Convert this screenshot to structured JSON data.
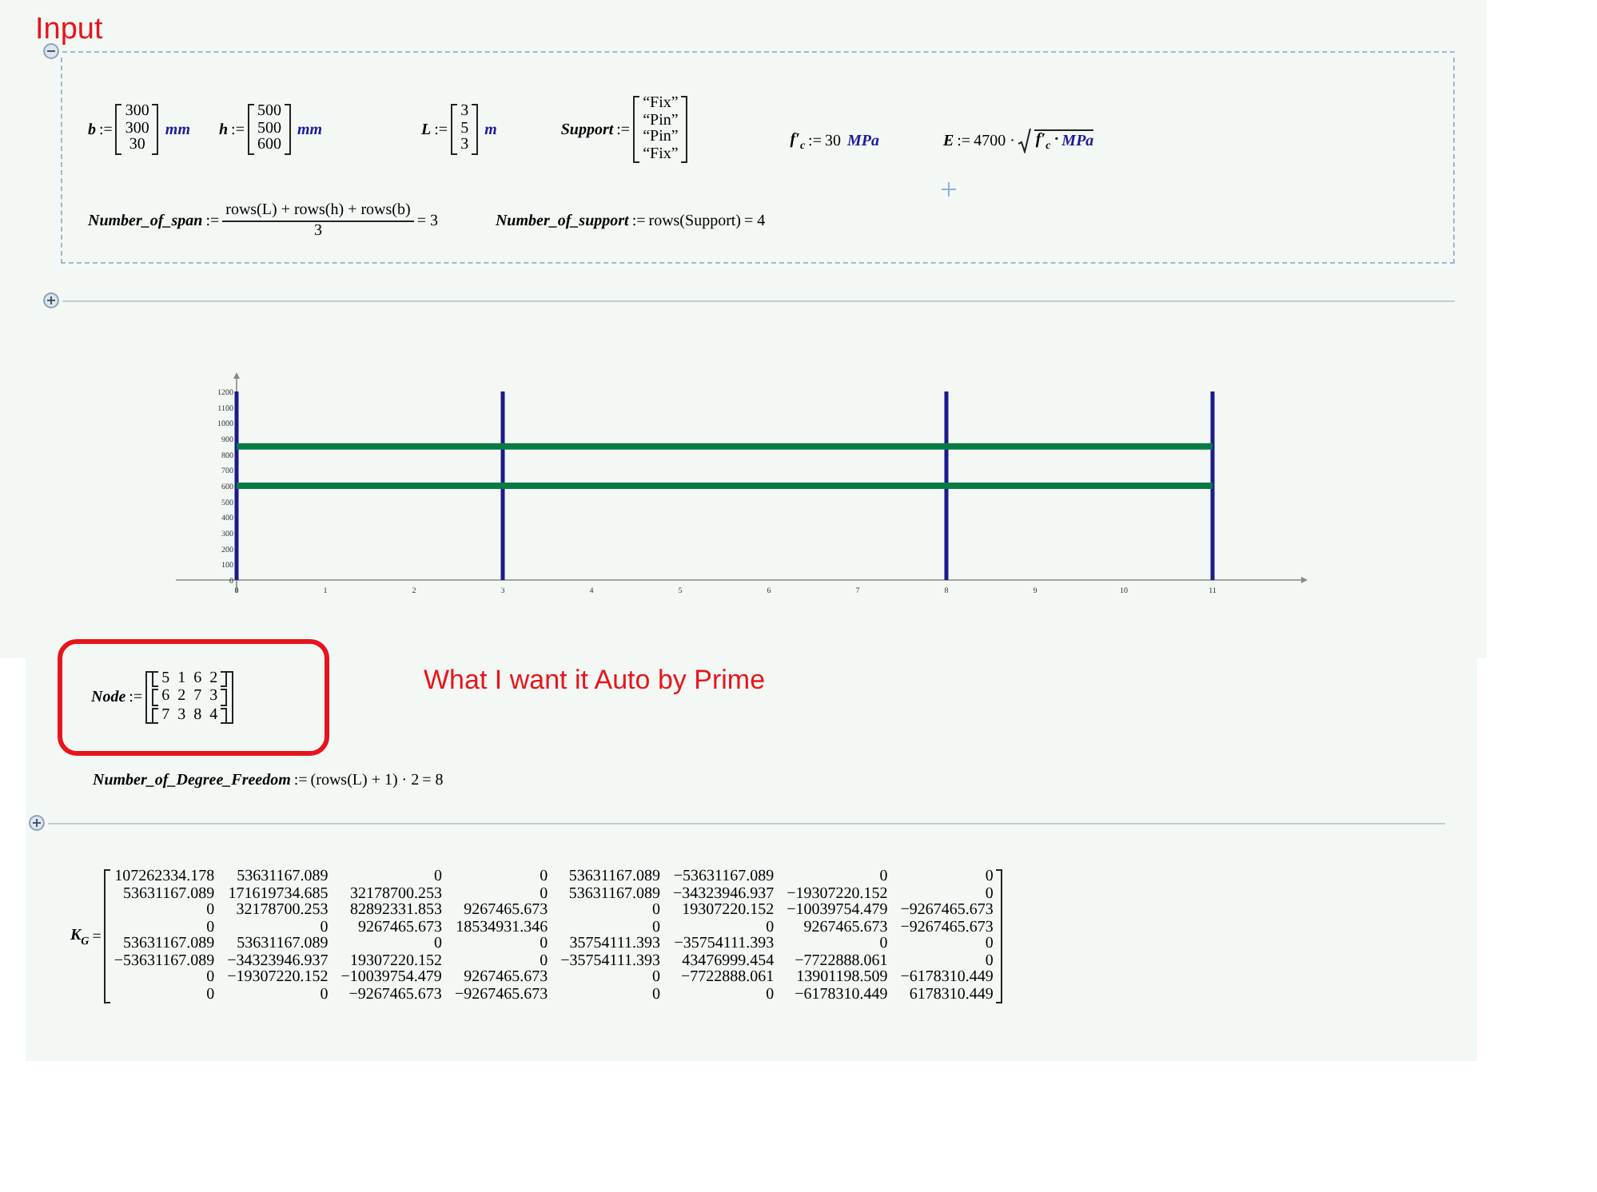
{
  "title": "Input",
  "input_region": {
    "expanded": true,
    "definitions": [
      {
        "kind": "vector",
        "name": "b",
        "op": ":=",
        "values": [
          "300",
          "300",
          "30"
        ],
        "unit": "mm"
      },
      {
        "kind": "vector",
        "name": "h",
        "op": ":=",
        "values": [
          "500",
          "500",
          "600"
        ],
        "unit": "mm"
      },
      {
        "kind": "vector",
        "name": "L",
        "op": ":=",
        "values": [
          "3",
          "5",
          "3"
        ],
        "unit": "m"
      },
      {
        "kind": "vector",
        "name": "Support",
        "op": ":=",
        "values": [
          "“Fix”",
          "“Pin”",
          "“Pin”",
          "“Fix”"
        ]
      },
      {
        "kind": "scalar",
        "name": "f′$_{c}$",
        "op": ":=",
        "value": "30",
        "unit": "MPa"
      },
      {
        "kind": "root",
        "name": "E",
        "op": ":=",
        "value": "4700 ·",
        "radicand": "f′$_{c}$ ·",
        "unit": "MPa"
      }
    ],
    "formulas": [
      {
        "kind": "fraction",
        "name": "Number_of_span",
        "op": ":=",
        "numerator": "rows(L) + rows(h) + rows(b)",
        "denominator": "3",
        "result": "= 3"
      },
      {
        "kind": "inline",
        "name": "Number_of_support",
        "op": ":=",
        "expression": "rows(Support)",
        "result": "= 4"
      }
    ]
  },
  "plot_region": {
    "expanded": false,
    "chart_data": {
      "type": "line",
      "xlim": [
        0,
        12
      ],
      "ylim": [
        0,
        1200
      ],
      "xticks": [
        0,
        1,
        2,
        3,
        4,
        5,
        6,
        7,
        8,
        9,
        10,
        11
      ],
      "yticks": [
        0,
        100,
        200,
        300,
        400,
        500,
        600,
        700,
        800,
        900,
        1000,
        1100,
        1200
      ],
      "series": [
        {
          "color": "#1a1a8c",
          "x": [
            0,
            0
          ],
          "values": [
            0,
            1200
          ]
        },
        {
          "color": "#1a1a8c",
          "x": [
            3,
            3
          ],
          "values": [
            0,
            1200
          ]
        },
        {
          "color": "#1a1a8c",
          "x": [
            8,
            8
          ],
          "values": [
            0,
            1200
          ]
        },
        {
          "color": "#1a1a8c",
          "x": [
            11,
            11
          ],
          "values": [
            0,
            1200
          ]
        },
        {
          "color": "#0a7a45",
          "x": [
            0,
            11
          ],
          "values": [
            850,
            850
          ]
        },
        {
          "color": "#0a7a45",
          "x": [
            0,
            11
          ],
          "values": [
            600,
            600
          ]
        }
      ]
    }
  },
  "node": {
    "name": "Node",
    "op": ":=",
    "rows": [
      [
        "5",
        "1",
        "6",
        "2"
      ],
      [
        "6",
        "2",
        "7",
        "3"
      ],
      [
        "7",
        "3",
        "8",
        "4"
      ]
    ]
  },
  "note": "What I want it Auto by Prime",
  "dof": {
    "name": "Number_of_Degree_Freedom",
    "op": ":=",
    "expression": "(rows(L) + 1) · 2",
    "result": "= 8"
  },
  "stiffness_region": {
    "expanded": false,
    "name": "K$_{G}$",
    "op": "=",
    "rows": [
      [
        "107262334.178",
        "53631167.089",
        "0",
        "0",
        "53631167.089",
        "−53631167.089",
        "0",
        "0"
      ],
      [
        "53631167.089",
        "171619734.685",
        "32178700.253",
        "0",
        "53631167.089",
        "−34323946.937",
        "−19307220.152",
        "0"
      ],
      [
        "0",
        "32178700.253",
        "82892331.853",
        "9267465.673",
        "0",
        "19307220.152",
        "−10039754.479",
        "−9267465.673"
      ],
      [
        "0",
        "0",
        "9267465.673",
        "18534931.346",
        "0",
        "0",
        "9267465.673",
        "−9267465.673"
      ],
      [
        "53631167.089",
        "53631167.089",
        "0",
        "0",
        "35754111.393",
        "−35754111.393",
        "0",
        "0"
      ],
      [
        "−53631167.089",
        "−34323946.937",
        "19307220.152",
        "0",
        "−35754111.393",
        "43476999.454",
        "−7722888.061",
        "0"
      ],
      [
        "0",
        "−19307220.152",
        "−10039754.479",
        "9267465.673",
        "0",
        "−7722888.061",
        "13901198.509",
        "−6178310.449"
      ],
      [
        "0",
        "0",
        "−9267465.673",
        "−9267465.673",
        "0",
        "0",
        "−6178310.449",
        "6178310.449"
      ]
    ]
  }
}
